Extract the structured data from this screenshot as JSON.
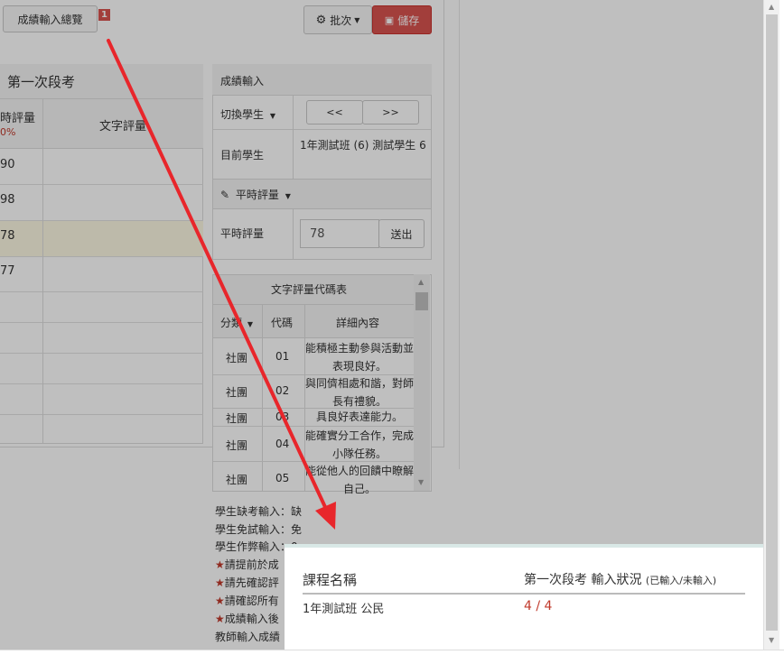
{
  "toolbar": {
    "overview_button": "成績輸入總覽",
    "badge_count": "1",
    "batch_button": "批次",
    "save_button": "儲存"
  },
  "exam_panel": {
    "title": "第一次段考",
    "col_quiz": "時評量",
    "col_quiz_pct": "0%",
    "col_text": "文字評量",
    "rows": [
      "90",
      "98",
      "78",
      "77",
      "",
      "",
      "",
      ""
    ]
  },
  "input_panel": {
    "title": "成績輸入",
    "switch_student": "切換學生",
    "prev": "<<",
    "next": ">>",
    "current_label": "目前學生",
    "current_value": "1年測試班 (6) 測試學生 6",
    "section_label": "平時評量",
    "quiz_label": "平時評量",
    "quiz_value": "78",
    "submit": "送出"
  },
  "code_table": {
    "title": "文字評量代碼表",
    "col_category": "分類",
    "col_code": "代碼",
    "col_detail": "詳細內容",
    "rows": [
      {
        "category": "社團",
        "code": "01",
        "detail": "能積極主動參與活動並表現良好。"
      },
      {
        "category": "社團",
        "code": "02",
        "detail": "與同儕相處和諧，對師長有禮貌。"
      },
      {
        "category": "社團",
        "code": "03",
        "detail": "具良好表達能力。"
      },
      {
        "category": "社團",
        "code": "04",
        "detail": "能確實分工合作，完成小隊任務。"
      },
      {
        "category": "社團",
        "code": "05",
        "detail": "能從他人的回饋中瞭解自己。"
      }
    ]
  },
  "notes": [
    "學生缺考輸入：缺",
    "學生免試輸入：免",
    "學生作弊輸入：0",
    "請提前於成",
    "請先確認評",
    "請確認所有",
    "成績輸入後",
    "教師輸入成績"
  ],
  "popup": {
    "col_course": "課程名稱",
    "col_status": "第一次段考 輸入狀況",
    "col_status_hint": "(已輸入/未輸入)",
    "row_course": "1年測試班 公民",
    "row_status": "4 / 4"
  },
  "colors": {
    "accent_red": "#d9534f",
    "arrow_red": "#e8262b"
  }
}
